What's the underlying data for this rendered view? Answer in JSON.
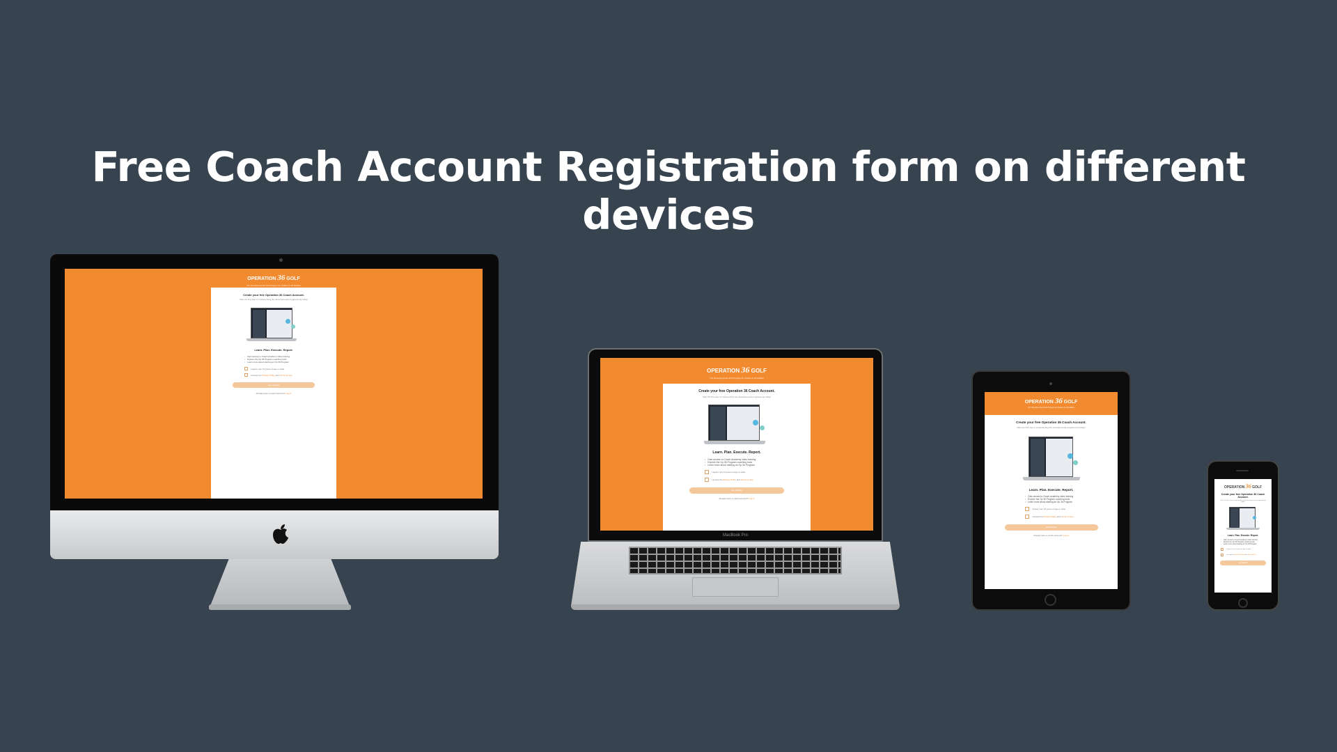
{
  "headline": "Free Coach Account Registration form on different devices",
  "accent_color": "#f28a2f",
  "background_color": "#37434f",
  "form": {
    "brand_left": "OPERATION",
    "brand_number": "36",
    "brand_right": "GOLF",
    "tagline": "The Developmental Golf Program for Golfers of all Abilities",
    "title": "Create your free Operation 36 Coach Account.",
    "subtitle": "Take the first step to implementing the developmental programming today!",
    "section_heading": "Learn. Plan. Execute. Report.",
    "bullets": [
      "Gain access to Coach Academy video training",
      "Explore the Op 36 Program coaching tools",
      "Learn more about starting an Op 36 Program"
    ],
    "checkbox_age": "I agree I am 13 years of age or older",
    "checkbox_terms_prefix": "I accept the",
    "privacy_link": "Privacy Policy",
    "checkbox_terms_and": "and",
    "terms_link": "Terms of Use",
    "submit_label": "Get Started",
    "already_text": "Already have a coach account?",
    "login_link": "Log in"
  },
  "laptop_label": "MacBook Pro",
  "logo_icon": "apple-logo-icon"
}
